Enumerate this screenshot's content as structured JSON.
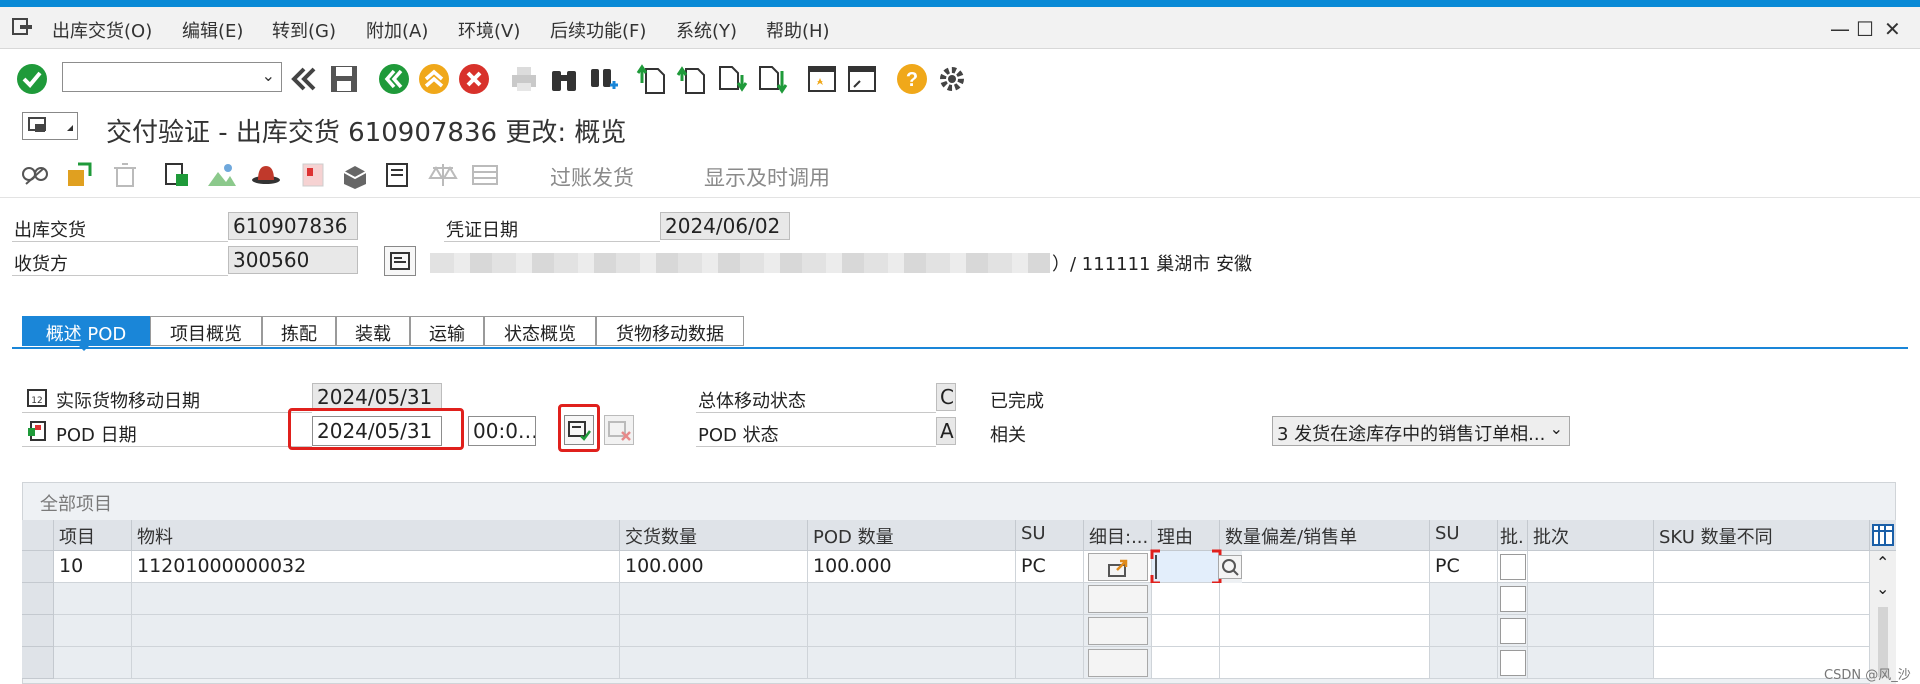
{
  "menu": {
    "items": [
      "出库交货(O)",
      "编辑(E)",
      "转到(G)",
      "附加(A)",
      "环境(V)",
      "后续功能(F)",
      "系统(Y)",
      "帮助(H)"
    ]
  },
  "window": {
    "minimize": "—",
    "maximize": "☐",
    "close": "✕"
  },
  "toolbar": {
    "command_value": "",
    "icons": [
      "enter-icon",
      "back-icon",
      "save-icon",
      "back-green-icon",
      "exit-icon",
      "cancel-icon",
      "print-icon",
      "find-icon",
      "find-next-icon",
      "first-page-icon",
      "prev-page-icon",
      "next-page-icon",
      "last-page-icon",
      "create-session-icon",
      "shortcut-icon",
      "help-icon",
      "settings-icon"
    ]
  },
  "title": {
    "text": "交付验证 - 出库交货 610907836 更改: 概览"
  },
  "app_toolbar": {
    "post_goods_issue": "过账发货",
    "display_and_call": "显示及时调用"
  },
  "header": {
    "delivery_label": "出库交货",
    "delivery_value": "610907836",
    "doc_date_label": "凭证日期",
    "doc_date_value": "2024/06/02",
    "ship_to_label": "收货方",
    "ship_to_value": "300560",
    "ship_to_address": "）/ 111111 巢湖市 安徽"
  },
  "tabs": [
    "概述 POD",
    "项目概览",
    "拣配",
    "装载",
    "运输",
    "状态概览",
    "货物移动数据"
  ],
  "pod": {
    "actual_gm_date_label": "实际货物移动日期",
    "actual_gm_date_value": "2024/05/31",
    "pod_date_label": "POD 日期",
    "pod_date_value": "2024/05/31",
    "pod_time_value": "00:0…",
    "overall_status_label": "总体移动状态",
    "overall_status_code": "C",
    "overall_status_text": "已完成",
    "pod_status_label": "POD 状态",
    "pod_status_code": "A",
    "pod_status_text": "相关",
    "relevance_select": "3 发货在途库存中的销售订单相..."
  },
  "grid": {
    "title": "全部项目",
    "columns": [
      "项目",
      "物料",
      "交货数量",
      "POD 数量",
      "SU",
      "细目:...",
      "理由",
      "数量偏差/销售单",
      "SU",
      "批.",
      "批次",
      "SKU 数量不同"
    ],
    "rows": [
      {
        "item": "10",
        "material": "11201000000032",
        "delivery_qty": "100.000",
        "pod_qty": "100.000",
        "su": "PC",
        "detail": "",
        "reason": "",
        "qty_diff": "",
        "su2": "PC",
        "batch_flag": "",
        "batch": "",
        "sku_diff": ""
      }
    ]
  },
  "watermark": "CSDN @风_沙",
  "colors": {
    "accent": "#1a86d8",
    "highlight": "#e0201c",
    "topbar": "#0a8ad6"
  }
}
